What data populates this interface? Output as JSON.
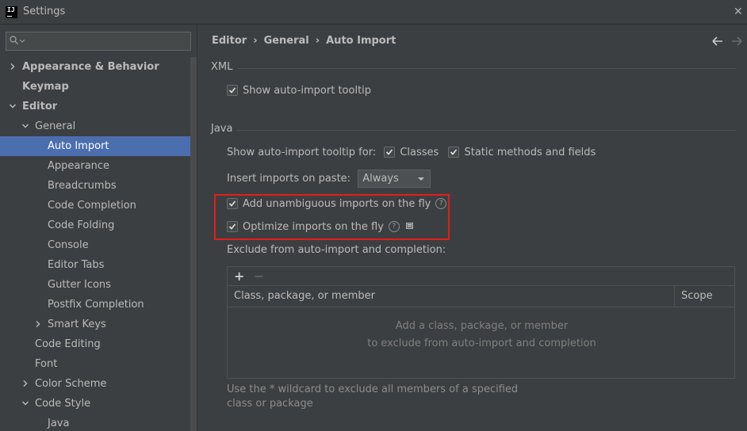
{
  "window": {
    "title": "Settings"
  },
  "sidebar": {
    "search_placeholder": "",
    "items": [
      {
        "label": "Appearance & Behavior",
        "level": 0,
        "arrow": "right",
        "bold": true
      },
      {
        "label": "Keymap",
        "level": 0,
        "arrow": "none",
        "bold": true
      },
      {
        "label": "Editor",
        "level": 0,
        "arrow": "down",
        "bold": true
      },
      {
        "label": "General",
        "level": 1,
        "arrow": "down"
      },
      {
        "label": "Auto Import",
        "level": 2,
        "arrow": "none",
        "selected": true
      },
      {
        "label": "Appearance",
        "level": 2,
        "arrow": "none"
      },
      {
        "label": "Breadcrumbs",
        "level": 2,
        "arrow": "none"
      },
      {
        "label": "Code Completion",
        "level": 2,
        "arrow": "none"
      },
      {
        "label": "Code Folding",
        "level": 2,
        "arrow": "none"
      },
      {
        "label": "Console",
        "level": 2,
        "arrow": "none"
      },
      {
        "label": "Editor Tabs",
        "level": 2,
        "arrow": "none"
      },
      {
        "label": "Gutter Icons",
        "level": 2,
        "arrow": "none"
      },
      {
        "label": "Postfix Completion",
        "level": 2,
        "arrow": "none"
      },
      {
        "label": "Smart Keys",
        "level": 2,
        "arrow": "right"
      },
      {
        "label": "Code Editing",
        "level": 1,
        "arrow": "none"
      },
      {
        "label": "Font",
        "level": 1,
        "arrow": "none"
      },
      {
        "label": "Color Scheme",
        "level": 1,
        "arrow": "right"
      },
      {
        "label": "Code Style",
        "level": 1,
        "arrow": "down"
      },
      {
        "label": "Java",
        "level": 2,
        "arrow": "none"
      }
    ]
  },
  "breadcrumb": [
    "Editor",
    "General",
    "Auto Import"
  ],
  "xml": {
    "title": "XML",
    "show_tooltip": {
      "label": "Show auto-import tooltip",
      "checked": true
    }
  },
  "java": {
    "title": "Java",
    "tooltip_for_label": "Show auto-import tooltip for:",
    "classes": {
      "label": "Classes",
      "checked": true
    },
    "static": {
      "label": "Static methods and fields",
      "checked": true
    },
    "insert_label": "Insert imports on paste:",
    "insert_value": "Always",
    "add_unambiguous": {
      "label": "Add unambiguous imports on the fly",
      "checked": true
    },
    "optimize": {
      "label": "Optimize imports on the fly",
      "checked": true
    },
    "exclude_label": "Exclude from auto-import and completion:",
    "table": {
      "add": "+",
      "remove": "−",
      "col_name": "Class, package, or member",
      "col_scope": "Scope",
      "empty_line1": "Add a class, package, or member",
      "empty_line2": "to exclude from auto-import and completion"
    },
    "hint": "Use the * wildcard to exclude all members of a specified class or package"
  },
  "icons": {
    "back": "arrow-left-icon",
    "forward": "arrow-right-icon",
    "help": "question-icon",
    "close": "close-icon"
  },
  "colors": {
    "selection": "#4b6eaf",
    "highlight": "#e61c1c",
    "background": "#3c3f41"
  }
}
